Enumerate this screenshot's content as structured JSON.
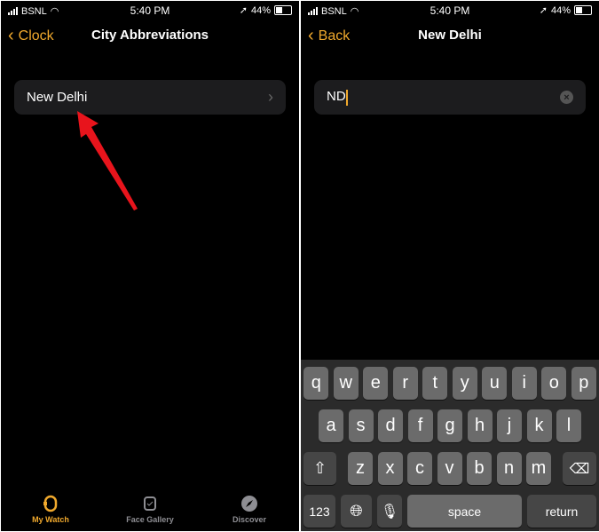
{
  "status": {
    "carrier": "BSNL",
    "time": "5:40 PM",
    "battery": "44%"
  },
  "left": {
    "back_label": "Clock",
    "title": "City Abbreviations",
    "row_label": "New Delhi",
    "tabs": [
      {
        "label": "My Watch",
        "icon": "watch-icon",
        "active": true
      },
      {
        "label": "Face Gallery",
        "icon": "watch-face-icon",
        "active": false
      },
      {
        "label": "Discover",
        "icon": "compass-icon",
        "active": false
      }
    ]
  },
  "right": {
    "back_label": "Back",
    "title": "New Delhi",
    "input_value": "ND"
  },
  "keyboard": {
    "row1": [
      "q",
      "w",
      "e",
      "r",
      "t",
      "y",
      "u",
      "i",
      "o",
      "p"
    ],
    "row2": [
      "a",
      "s",
      "d",
      "f",
      "g",
      "h",
      "j",
      "k",
      "l"
    ],
    "row3": [
      "z",
      "x",
      "c",
      "v",
      "b",
      "n",
      "m"
    ],
    "numbers": "123",
    "space": "space",
    "return": "return"
  },
  "colors": {
    "accent": "#f0a92d",
    "annotation_arrow": "#e8141c"
  }
}
